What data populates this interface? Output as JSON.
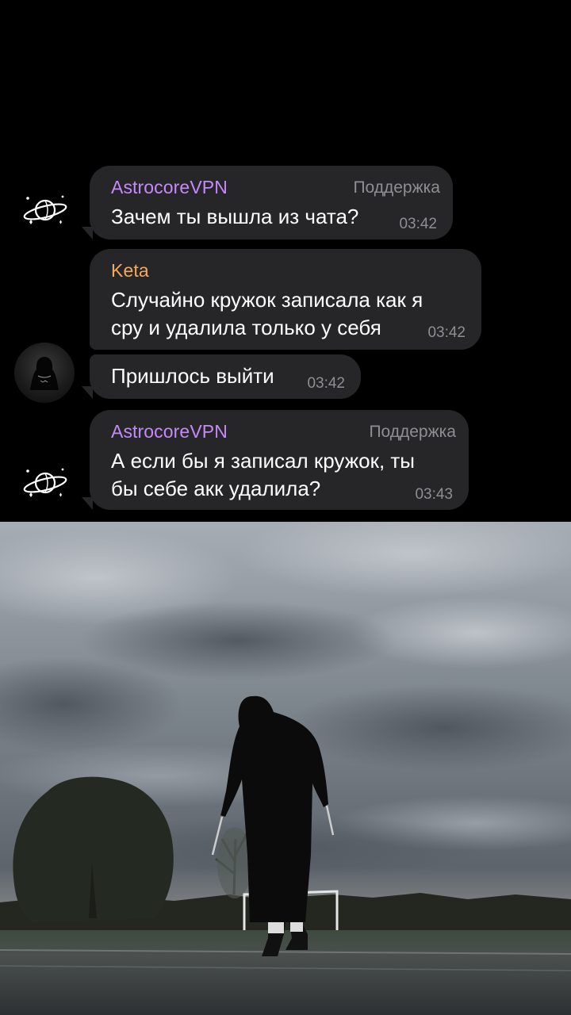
{
  "messages": [
    {
      "sender": "AstrocoreVPN",
      "role": "Поддержка",
      "text": "Зачем ты вышла из чата?",
      "time": "03:42"
    },
    {
      "sender": "Keta",
      "text": "Случайно кружок записала как я\nсру и удалила только у себя",
      "time": "03:42"
    },
    {
      "text": "Пришлось выйти",
      "time": "03:42"
    },
    {
      "sender": "AstrocoreVPN",
      "role": "Поддержка",
      "text": "А если бы я записал кружок, ты\nбы себе акк удалила?",
      "time": "03:43"
    }
  ],
  "colors": {
    "background": "#000000",
    "bubble": "#262628",
    "sender_astrocore": "#c58af9",
    "sender_keta": "#f5a85c",
    "meta_text": "#8e8e93"
  },
  "icons": {
    "astrocore_avatar": "saturn-planet-icon",
    "keta_avatar": "user-photo-avatar"
  }
}
